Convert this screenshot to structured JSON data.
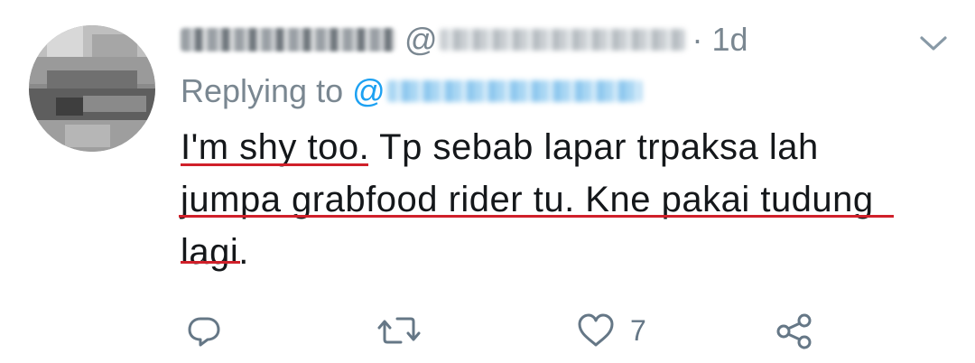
{
  "tweet": {
    "handle_prefix": "@",
    "separator_time": "· 1d",
    "replying_to_label": "Replying to",
    "replying_at": "@",
    "text_lines": [
      "I'm  shy too. Tp sebab lapar trpaksa lah",
      "jumpa grabfood rider tu.  Kne pakai tudung",
      "lagi."
    ]
  },
  "actions": {
    "reply_icon": "reply-icon",
    "retweet_icon": "retweet-icon",
    "like_icon": "heart-icon",
    "like_count": "7",
    "share_icon": "share-icon"
  },
  "colors": {
    "text": "#14171a",
    "secondary": "#7a8791",
    "link": "#1da1f2",
    "annotation_underline": "#d0202a"
  }
}
